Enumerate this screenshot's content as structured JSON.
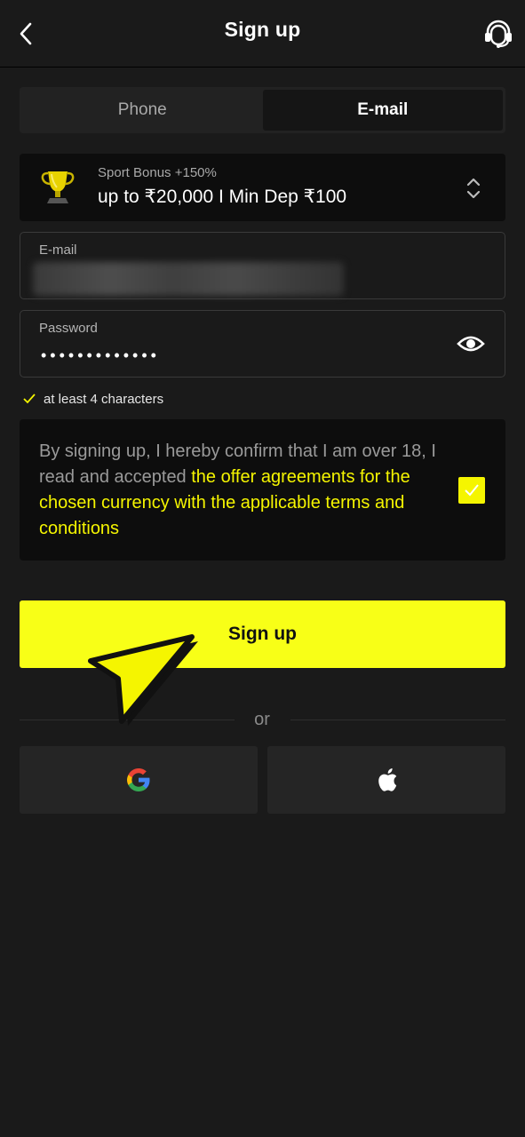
{
  "header": {
    "title": "Sign up",
    "back_icon": "chevron-left-icon",
    "support_icon": "headset-icon"
  },
  "tabs": [
    {
      "label": "Phone",
      "active": false
    },
    {
      "label": "E-mail",
      "active": true
    }
  ],
  "bonus": {
    "label": "Sport Bonus +150%",
    "value": "up to ₹20,000 I Min Dep ₹100",
    "icon": "trophy-icon"
  },
  "email_field": {
    "label": "E-mail",
    "value_obscured": true
  },
  "password_field": {
    "label": "Password",
    "masked_value": "•••••••••••••"
  },
  "password_hint": "at least 4 characters",
  "terms": {
    "prefix": "By signing up, I hereby confirm that I am over 18, I read and accepted ",
    "link": "the offer agreements for the chosen currency with the applicable terms and conditions",
    "checked": true
  },
  "signup_button": "Sign up",
  "or_label": "or",
  "social": [
    {
      "name": "google",
      "icon": "google-icon"
    },
    {
      "name": "apple",
      "icon": "apple-icon"
    }
  ],
  "colors": {
    "accent": "#f8ff17",
    "background": "#1a1a1a",
    "card": "#0d0d0d"
  }
}
